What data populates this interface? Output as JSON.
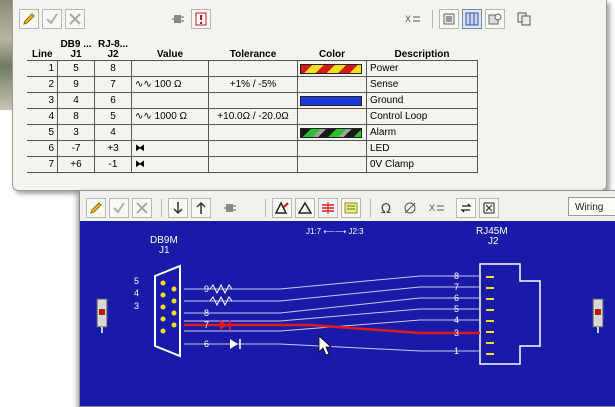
{
  "colors": {
    "canvas_blue": "#1a1aa8",
    "power": [
      "#d81818",
      "#f0e020"
    ],
    "ground": "#1a3ad8",
    "alarm": [
      "#1a1a1a",
      "#2cc02c",
      "#a0a0a0"
    ],
    "highlight_wire": "#e01818"
  },
  "toolbar_top": {
    "left_icons": [
      "pencil-icon",
      "check-icon",
      "cross-icon"
    ],
    "mid_icons": [
      "connector-icon",
      "warning-doc-icon"
    ],
    "right_icons": [
      "swap-icon",
      "table-view-icon",
      "grid-view-icon",
      "settings-icon",
      "copy-icon"
    ]
  },
  "table": {
    "headers": {
      "line": "Line",
      "j1_top": "DB9 ...",
      "j1": "J1",
      "j2_top": "RJ-8...",
      "j2": "J2",
      "value": "Value",
      "tolerance": "Tolerance",
      "color": "Color",
      "description": "Description"
    },
    "rows": [
      {
        "line": "1",
        "j1": "5",
        "j2": "8",
        "value": "",
        "tolerance": "",
        "color": "power",
        "description": "Power"
      },
      {
        "line": "2",
        "j1": "9",
        "j2": "7",
        "value": "∿∿ 100 Ω",
        "tolerance": "+1% / -5%",
        "color": "",
        "description": "Sense"
      },
      {
        "line": "3",
        "j1": "4",
        "j2": "6",
        "value": "",
        "tolerance": "",
        "color": "ground",
        "description": "Ground"
      },
      {
        "line": "4",
        "j1": "8",
        "j2": "5",
        "value": "∿∿ 1000 Ω",
        "tolerance": "+10.0Ω / -20.0Ω",
        "color": "",
        "description": "Control Loop"
      },
      {
        "line": "5",
        "j1": "3",
        "j2": "4",
        "value": "",
        "tolerance": "",
        "color": "alarm",
        "description": "Alarm"
      },
      {
        "line": "6",
        "j1": "-7",
        "j2": "+3",
        "value": "⧓",
        "tolerance": "",
        "color": "",
        "description": "LED"
      },
      {
        "line": "7",
        "j1": "+6",
        "j2": "-1",
        "value": "⧓",
        "tolerance": "",
        "color": "",
        "description": "0V Clamp"
      }
    ]
  },
  "toolbar_bottom": {
    "icons": [
      "pencil-icon",
      "check-icon",
      "cross-icon",
      "arrow-down-icon",
      "arrow-up-icon",
      "connector-icon",
      "triangle-edit-icon",
      "triangle-icon",
      "red-lines-icon",
      "yellow-lines-icon",
      "omega-icon",
      "phase-icon",
      "swap-icon",
      "refresh-icon",
      "fit-icon"
    ],
    "wiring_label": "Wiring"
  },
  "schematic": {
    "j1_name": "DB9M",
    "j1_id": "J1",
    "j2_name": "RJ45M",
    "j2_id": "J2",
    "span_label": "J1:7 ⟵⟶ J2:3",
    "left_pins": [
      "5",
      "4",
      "3"
    ],
    "right_pins": [
      "8",
      "7",
      "6",
      "5",
      "4",
      "3",
      "1"
    ],
    "mid_pins": [
      "9",
      "8",
      "7",
      "6"
    ]
  }
}
